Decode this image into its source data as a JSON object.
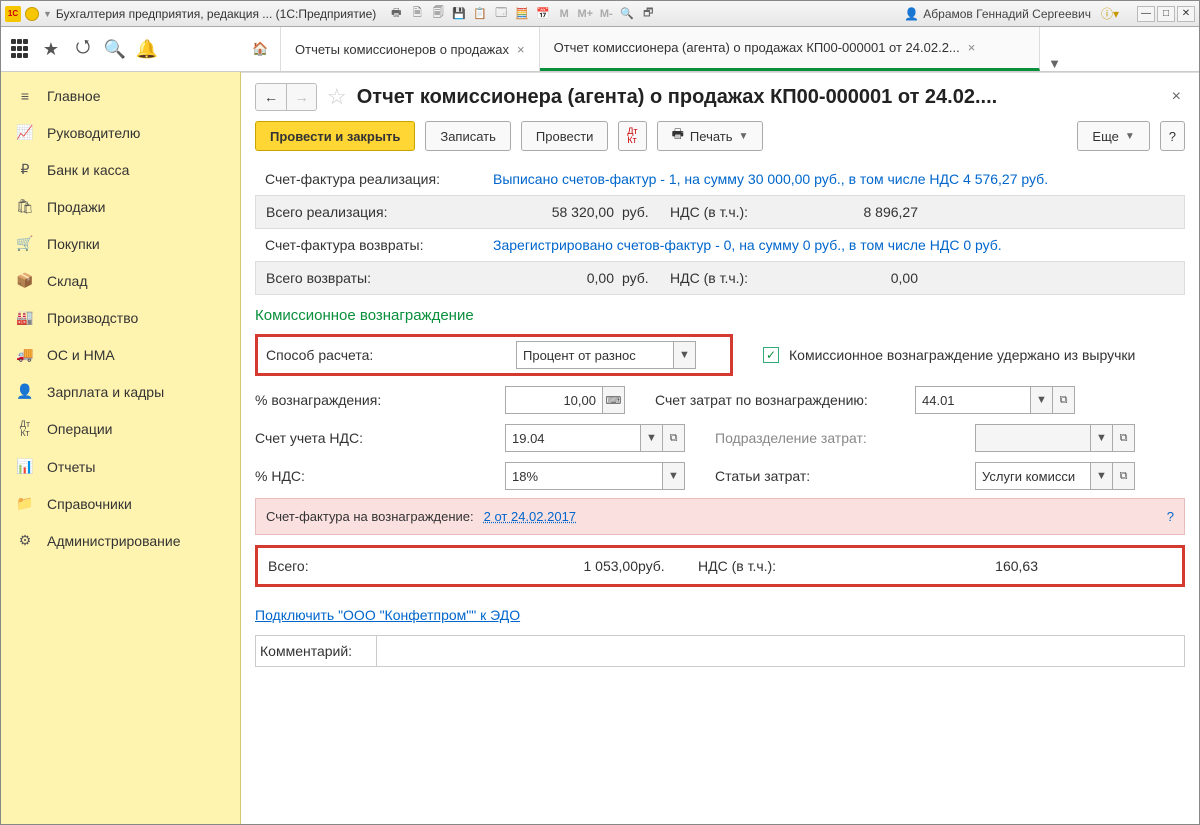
{
  "titlebar": {
    "app_title": "Бухгалтерия предприятия, редакция ... (1С:Предприятие)",
    "user": "Абрамов Геннадий Сергеевич",
    "m_labels": [
      "M",
      "M+",
      "M-"
    ]
  },
  "tabs": {
    "tab1": "Отчеты комиссионеров о продажах",
    "tab2": "Отчет комиссионера (агента) о продажах КП00-000001 от 24.02.2..."
  },
  "sidebar": {
    "items": [
      "Главное",
      "Руководителю",
      "Банк и касса",
      "Продажи",
      "Покупки",
      "Склад",
      "Производство",
      "ОС и НМА",
      "Зарплата и кадры",
      "Операции",
      "Отчеты",
      "Справочники",
      "Администрирование"
    ]
  },
  "doc": {
    "title": "Отчет комиссионера (агента) о продажах КП00-000001 от 24.02....",
    "post_close": "Провести и закрыть",
    "save": "Записать",
    "post": "Провести",
    "print": "Печать",
    "more": "Еще",
    "sf_real_label": "Счет-фактура реализация:",
    "sf_real_link": "Выписано счетов-фактур - 1, на сумму 30 000,00 руб., в том числе НДС 4 576,27 руб.",
    "total_real_label": "Всего реализация:",
    "total_real_val": "58 320,00",
    "rub": "руб.",
    "nds_label": "НДС (в т.ч.):",
    "total_real_nds": "8 896,27",
    "sf_ret_label": "Счет-фактура возвраты:",
    "sf_ret_link": "Зарегистрировано счетов-фактур - 0, на сумму 0 руб., в том числе НДС 0 руб.",
    "total_ret_label": "Всего возвраты:",
    "total_ret_val": "0,00",
    "total_ret_nds": "0,00",
    "section_title": "Комиссионное вознаграждение",
    "calc_method_label": "Способ расчета:",
    "calc_method": "Процент от разнос",
    "check_label": "Комиссионное вознаграждение удержано из выручки",
    "pct_label": "% вознаграждения:",
    "pct_val": "10,00",
    "cost_acc_label": "Счет затрат по вознаграждению:",
    "cost_acc_val": "44.01",
    "vat_acc_label": "Счет учета НДС:",
    "vat_acc_val": "19.04",
    "dept_label": "Подразделение затрат:",
    "dept_val": "",
    "vat_pct_label": "% НДС:",
    "vat_pct_val": "18%",
    "cost_item_label": "Статьи затрат:",
    "cost_item_val": "Услуги комисси",
    "sf_fee_label": "Счет-фактура на вознаграждение:",
    "sf_fee_link": "2 от 24.02.2017",
    "total_label": "Всего:",
    "total_val": "1 053,00",
    "total_nds": "160,63",
    "edo_link": "Подключить \"ООО \"Конфетпром\"\" к ЭДО",
    "comment_label": "Комментарий:",
    "dtkt": "Дт\nКт"
  }
}
